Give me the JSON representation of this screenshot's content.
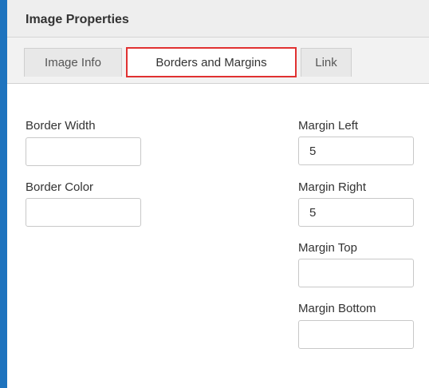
{
  "dialog": {
    "title": "Image Properties"
  },
  "tabs": [
    {
      "label": "Image Info",
      "active": false
    },
    {
      "label": "Borders and Margins",
      "active": true
    },
    {
      "label": "Link",
      "active": false
    }
  ],
  "fields": {
    "border_width": {
      "label": "Border Width",
      "value": ""
    },
    "border_color": {
      "label": "Border Color",
      "value": ""
    },
    "margin_left": {
      "label": "Margin Left",
      "value": "5"
    },
    "margin_right": {
      "label": "Margin Right",
      "value": "5"
    },
    "margin_top": {
      "label": "Margin Top",
      "value": ""
    },
    "margin_bottom": {
      "label": "Margin Bottom",
      "value": ""
    }
  },
  "colors": {
    "accent_border": "#1e73be",
    "active_tab_highlight": "#e03131"
  }
}
